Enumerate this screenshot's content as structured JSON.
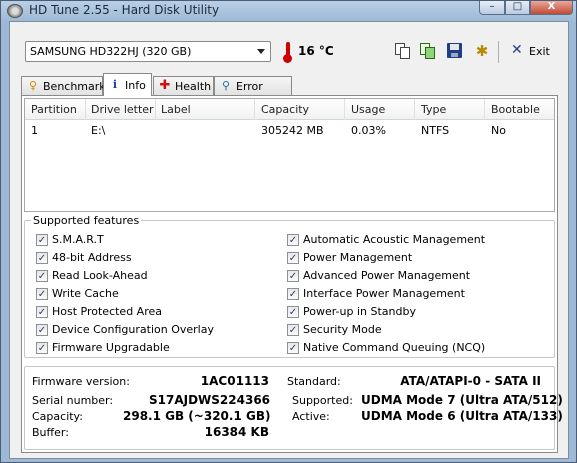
{
  "window": {
    "title": "HD Tune 2.55 - Hard Disk Utility",
    "controls": {
      "minimize": "–",
      "maximize": "□",
      "close": "X"
    }
  },
  "toolbar": {
    "drive": "SAMSUNG HD322HJ (320 GB)",
    "temperature": "16 °C",
    "exit_label": "Exit",
    "icons": [
      "copy-text-icon",
      "copy-screenshot-icon",
      "save-icon",
      "options-icon",
      "exit-icon"
    ]
  },
  "tabs": [
    {
      "label": "Benchmark",
      "icon": "benchmark-icon",
      "active": false
    },
    {
      "label": "Info",
      "icon": "info-icon",
      "active": true
    },
    {
      "label": "Health",
      "icon": "health-icon",
      "active": false
    },
    {
      "label": "Error Scan",
      "icon": "error-scan-icon",
      "active": false
    }
  ],
  "partitions": {
    "columns": [
      "Partition",
      "Drive letter",
      "Label",
      "Capacity",
      "Usage",
      "Type",
      "Bootable"
    ],
    "rows": [
      {
        "partition": "1",
        "drive_letter": "E:\\",
        "label": "",
        "capacity": "305242 MB",
        "usage": "0.03%",
        "type": "NTFS",
        "bootable": "No"
      }
    ]
  },
  "features": {
    "title": "Supported features",
    "left": [
      {
        "label": "S.M.A.R.T",
        "checked": true
      },
      {
        "label": "48-bit Address",
        "checked": true
      },
      {
        "label": "Read Look-Ahead",
        "checked": true
      },
      {
        "label": "Write Cache",
        "checked": true
      },
      {
        "label": "Host Protected Area",
        "checked": true
      },
      {
        "label": "Device Configuration Overlay",
        "checked": true
      },
      {
        "label": "Firmware Upgradable",
        "checked": true
      }
    ],
    "right": [
      {
        "label": "Automatic Acoustic Management",
        "checked": true
      },
      {
        "label": "Power Management",
        "checked": true
      },
      {
        "label": "Advanced Power Management",
        "checked": true
      },
      {
        "label": "Interface Power Management",
        "checked": true
      },
      {
        "label": "Power-up in Standby",
        "checked": true
      },
      {
        "label": "Security Mode",
        "checked": true
      },
      {
        "label": "Native Command Queuing (NCQ)",
        "checked": true
      }
    ]
  },
  "details": {
    "firmware_label": "Firmware version:",
    "firmware": "1AC01113",
    "serial_label": "Serial number:",
    "serial": "S17AJDWS224366",
    "capacity_label": "Capacity:",
    "capacity": "298.1 GB (~320.1 GB)",
    "buffer_label": "Buffer:",
    "buffer": "16384 KB",
    "standard_label": "Standard:",
    "standard": "ATA/ATAPI-0 - SATA II",
    "supported_label": "Supported:",
    "supported": "UDMA Mode 7 (Ultra ATA/512)",
    "active_label": "Active:",
    "active": "UDMA Mode 6 (Ultra ATA/133)"
  },
  "colors": {
    "window_frame": "#9db9d6",
    "client_bg": "#f0f0f0",
    "close_button": "#c24a35",
    "thermometer": "#cc0000",
    "check_mark": "#263d6b"
  }
}
